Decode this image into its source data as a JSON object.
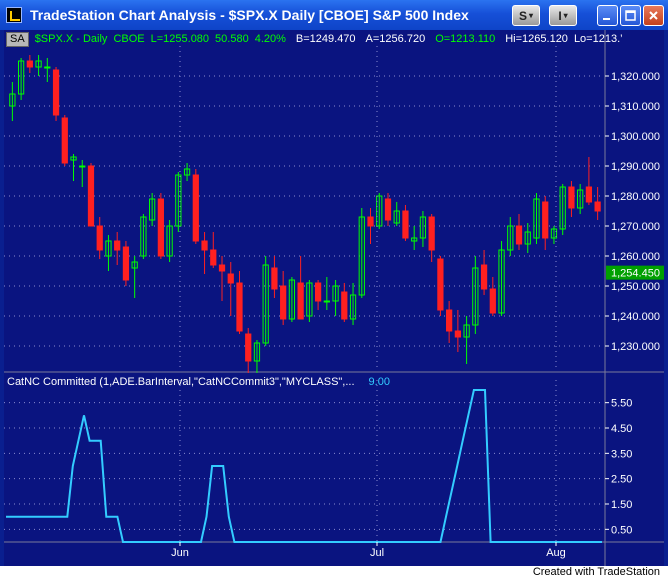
{
  "window": {
    "title": "TradeStation Chart Analysis - $SPX.X  Daily  [CBOE] S&P 500 Index",
    "buttons": {
      "s_label": "S",
      "i_label": "I"
    }
  },
  "symbol_bar": {
    "tag": "SA",
    "symbol": "$SPX.X - Daily",
    "exchange": "CBOE",
    "last": "L=1255.080",
    "change": "50.580",
    "pct_change": "4.20%",
    "bid": "B=1249.470",
    "ask": "A=1256.720",
    "open": "O=1213.110",
    "high": "Hi=1265.120",
    "low": "Lo=1213.’"
  },
  "price_axis": {
    "ticks": [
      "1,320.000",
      "1,310.000",
      "1,300.000",
      "1,290.000",
      "1,280.000",
      "1,270.000",
      "1,260.000",
      "1,250.000",
      "1,240.000",
      "1,230.000"
    ],
    "last_price_label": "1,254.450"
  },
  "indicator": {
    "label": "CatNC Committed (1,ADE.BarInterval,\"CatNCCommit3\",\"MYCLASS\",...",
    "value": "9.00",
    "ticks": [
      "5.50",
      "4.50",
      "3.50",
      "2.50",
      "1.50",
      "0.50"
    ]
  },
  "time_axis": {
    "labels": [
      "Jun",
      "Jul",
      "Aug"
    ]
  },
  "footer": {
    "credit": "Created with TradeStation"
  },
  "colors": {
    "up": "#00ff00",
    "down": "#ff2020",
    "indicator_line": "#33ccff",
    "last_badge": "#00a000"
  },
  "chart_data": [
    {
      "type": "candlestick",
      "title": "$SPX.X - Daily",
      "ylim": [
        1222,
        1330
      ],
      "x_labels": [
        "Jun",
        "Jul",
        "Aug"
      ],
      "ohlc": [
        {
          "o": 1310,
          "h": 1318,
          "l": 1305,
          "c": 1314
        },
        {
          "o": 1314,
          "h": 1326,
          "l": 1312,
          "c": 1325
        },
        {
          "o": 1325,
          "h": 1327,
          "l": 1321,
          "c": 1323
        },
        {
          "o": 1323,
          "h": 1327,
          "l": 1320,
          "c": 1325
        },
        {
          "o": 1323,
          "h": 1326,
          "l": 1318,
          "c": 1323
        },
        {
          "o": 1322,
          "h": 1323,
          "l": 1305,
          "c": 1307
        },
        {
          "o": 1306,
          "h": 1307,
          "l": 1290,
          "c": 1291
        },
        {
          "o": 1292,
          "h": 1294,
          "l": 1285,
          "c": 1293
        },
        {
          "o": 1290,
          "h": 1292,
          "l": 1283,
          "c": 1290
        },
        {
          "o": 1290,
          "h": 1291,
          "l": 1270,
          "c": 1270
        },
        {
          "o": 1270,
          "h": 1273,
          "l": 1259,
          "c": 1262
        },
        {
          "o": 1260,
          "h": 1267,
          "l": 1255,
          "c": 1265
        },
        {
          "o": 1265,
          "h": 1268,
          "l": 1257,
          "c": 1262
        },
        {
          "o": 1263,
          "h": 1265,
          "l": 1250,
          "c": 1252
        },
        {
          "o": 1256,
          "h": 1260,
          "l": 1246,
          "c": 1258
        },
        {
          "o": 1260,
          "h": 1274,
          "l": 1259,
          "c": 1273
        },
        {
          "o": 1272,
          "h": 1281,
          "l": 1270,
          "c": 1279
        },
        {
          "o": 1279,
          "h": 1281,
          "l": 1259,
          "c": 1260
        },
        {
          "o": 1260,
          "h": 1272,
          "l": 1258,
          "c": 1270
        },
        {
          "o": 1270,
          "h": 1288,
          "l": 1268,
          "c": 1287
        },
        {
          "o": 1287,
          "h": 1291,
          "l": 1285,
          "c": 1289
        },
        {
          "o": 1287,
          "h": 1289,
          "l": 1264,
          "c": 1265
        },
        {
          "o": 1265,
          "h": 1268,
          "l": 1254,
          "c": 1262
        },
        {
          "o": 1262,
          "h": 1268,
          "l": 1256,
          "c": 1257
        },
        {
          "o": 1257,
          "h": 1260,
          "l": 1245,
          "c": 1255
        },
        {
          "o": 1254,
          "h": 1258,
          "l": 1240,
          "c": 1251
        },
        {
          "o": 1251,
          "h": 1255,
          "l": 1234,
          "c": 1235
        },
        {
          "o": 1234,
          "h": 1236,
          "l": 1221,
          "c": 1225
        },
        {
          "o": 1225,
          "h": 1232,
          "l": 1221,
          "c": 1231
        },
        {
          "o": 1231,
          "h": 1260,
          "l": 1230,
          "c": 1257
        },
        {
          "o": 1256,
          "h": 1260,
          "l": 1246,
          "c": 1249
        },
        {
          "o": 1250,
          "h": 1255,
          "l": 1237,
          "c": 1239
        },
        {
          "o": 1239,
          "h": 1253,
          "l": 1238,
          "c": 1252
        },
        {
          "o": 1251,
          "h": 1260,
          "l": 1239,
          "c": 1239
        },
        {
          "o": 1240,
          "h": 1252,
          "l": 1238,
          "c": 1251
        },
        {
          "o": 1251,
          "h": 1252,
          "l": 1242,
          "c": 1245
        },
        {
          "o": 1245,
          "h": 1253,
          "l": 1242,
          "c": 1245
        },
        {
          "o": 1245,
          "h": 1252,
          "l": 1240,
          "c": 1250
        },
        {
          "o": 1248,
          "h": 1251,
          "l": 1238,
          "c": 1239
        },
        {
          "o": 1239,
          "h": 1251,
          "l": 1237,
          "c": 1247
        },
        {
          "o": 1247,
          "h": 1276,
          "l": 1246,
          "c": 1273
        },
        {
          "o": 1273,
          "h": 1276,
          "l": 1264,
          "c": 1270
        },
        {
          "o": 1270,
          "h": 1281,
          "l": 1269,
          "c": 1280
        },
        {
          "o": 1279,
          "h": 1281,
          "l": 1270,
          "c": 1272
        },
        {
          "o": 1271,
          "h": 1278,
          "l": 1270,
          "c": 1275
        },
        {
          "o": 1275,
          "h": 1277,
          "l": 1265,
          "c": 1266
        },
        {
          "o": 1265,
          "h": 1270,
          "l": 1262,
          "c": 1266
        },
        {
          "o": 1266,
          "h": 1275,
          "l": 1263,
          "c": 1273
        },
        {
          "o": 1273,
          "h": 1274,
          "l": 1258,
          "c": 1262
        },
        {
          "o": 1259,
          "h": 1260,
          "l": 1240,
          "c": 1242
        },
        {
          "o": 1242,
          "h": 1245,
          "l": 1231,
          "c": 1235
        },
        {
          "o": 1235,
          "h": 1242,
          "l": 1228,
          "c": 1233
        },
        {
          "o": 1233,
          "h": 1240,
          "l": 1224,
          "c": 1237
        },
        {
          "o": 1237,
          "h": 1260,
          "l": 1234,
          "c": 1256
        },
        {
          "o": 1257,
          "h": 1262,
          "l": 1247,
          "c": 1249
        },
        {
          "o": 1249,
          "h": 1253,
          "l": 1240,
          "c": 1241
        },
        {
          "o": 1241,
          "h": 1265,
          "l": 1240,
          "c": 1262
        },
        {
          "o": 1262,
          "h": 1273,
          "l": 1260,
          "c": 1270
        },
        {
          "o": 1270,
          "h": 1274,
          "l": 1262,
          "c": 1264
        },
        {
          "o": 1264,
          "h": 1271,
          "l": 1261,
          "c": 1268
        },
        {
          "o": 1266,
          "h": 1281,
          "l": 1264,
          "c": 1279
        },
        {
          "o": 1278,
          "h": 1280,
          "l": 1262,
          "c": 1266
        },
        {
          "o": 1266,
          "h": 1270,
          "l": 1264,
          "c": 1269
        },
        {
          "o": 1269,
          "h": 1284,
          "l": 1267,
          "c": 1283
        },
        {
          "o": 1283,
          "h": 1285,
          "l": 1273,
          "c": 1276
        },
        {
          "o": 1276,
          "h": 1284,
          "l": 1274,
          "c": 1282
        },
        {
          "o": 1283,
          "h": 1293,
          "l": 1277,
          "c": 1278
        },
        {
          "o": 1278,
          "h": 1283,
          "l": 1272,
          "c": 1275
        }
      ]
    },
    {
      "type": "line",
      "title": "CatNC Committed",
      "ylim": [
        0,
        6
      ],
      "series": [
        {
          "values": [
            1,
            1,
            1,
            1,
            1,
            1,
            1,
            1,
            1,
            1,
            1,
            1,
            3,
            4,
            5,
            4,
            4,
            4,
            1,
            1,
            1,
            0,
            0,
            0,
            0,
            0,
            0,
            0,
            0,
            0,
            0,
            0,
            0,
            0,
            0,
            0,
            1,
            3,
            3,
            3,
            1,
            0,
            0,
            0,
            0,
            0,
            0,
            0,
            0,
            0,
            0,
            0,
            0,
            0,
            0,
            0,
            0,
            0,
            0,
            0,
            0,
            0,
            0,
            0,
            0,
            0,
            0,
            0,
            0,
            0,
            0,
            0,
            0,
            0,
            0,
            0,
            0,
            0,
            0,
            1,
            2,
            3,
            4,
            5,
            6,
            6,
            6,
            0,
            0,
            0,
            0,
            0,
            0,
            0,
            0,
            0,
            0,
            0,
            0,
            0,
            0,
            0,
            0,
            0,
            0,
            0,
            0,
            0
          ]
        }
      ]
    }
  ]
}
